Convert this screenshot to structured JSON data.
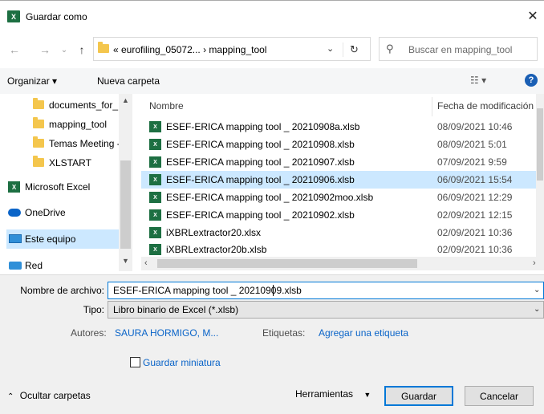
{
  "window": {
    "app_icon": "excel-icon",
    "title": "Guardar como",
    "close_label": "✕"
  },
  "address_bar": {
    "path_text": "« eurofiling_05072...  ›  mapping_tool",
    "search_placeholder": "Buscar en mapping_tool"
  },
  "toolbar": {
    "organize_label": "Organizar ▾",
    "new_folder_label": "Nueva carpeta"
  },
  "nav_pane": {
    "items": [
      {
        "label": "documents_for_",
        "icon": "folder-icon"
      },
      {
        "label": "mapping_tool",
        "icon": "folder-icon"
      },
      {
        "label": "Temas Meeting -",
        "icon": "folder-icon"
      },
      {
        "label": "XLSTART",
        "icon": "folder-icon"
      },
      {
        "label": "Microsoft Excel",
        "icon": "excel-icon"
      },
      {
        "label": "OneDrive",
        "icon": "cloud-icon"
      },
      {
        "label": "Este equipo",
        "icon": "computer-icon",
        "selected": true
      },
      {
        "label": "Red",
        "icon": "network-icon"
      }
    ]
  },
  "file_list": {
    "columns": [
      "Nombre",
      "Fecha de modificación"
    ],
    "rows": [
      {
        "name": "ESEF-ERICA mapping tool _ 20210908a.xlsb",
        "date": "08/09/2021 10:46"
      },
      {
        "name": "ESEF-ERICA mapping tool _ 20210908.xlsb",
        "date": "08/09/2021 5:01"
      },
      {
        "name": "ESEF-ERICA mapping tool _ 20210907.xlsb",
        "date": "07/09/2021 9:59"
      },
      {
        "name": "ESEF-ERICA mapping tool _ 20210906.xlsb",
        "date": "06/09/2021 15:54",
        "selected": true
      },
      {
        "name": "ESEF-ERICA mapping tool _ 20210902moo.xlsb",
        "date": "06/09/2021 12:29"
      },
      {
        "name": "ESEF-ERICA mapping tool _ 20210902.xlsb",
        "date": "02/09/2021 12:15"
      },
      {
        "name": "iXBRLextractor20.xlsx",
        "date": "02/09/2021 10:36"
      },
      {
        "name": "iXBRLextractor20b.xlsb",
        "date": "02/09/2021 10:36"
      }
    ]
  },
  "form": {
    "filename_label": "Nombre de archivo:",
    "filename_value": "ESEF-ERICA mapping tool _ 20210909.xlsb",
    "type_label": "Tipo:",
    "type_value": "Libro binario de Excel (*.xlsb)",
    "authors_label": "Autores:",
    "authors_value": "SAURA HORMIGO, M...",
    "tags_label": "Etiquetas:",
    "tags_value": "Agregar una etiqueta",
    "thumbnail_label": "Guardar miniatura"
  },
  "footer": {
    "hide_folders_label": "Ocultar carpetas",
    "tools_label": "Herramientas",
    "save_label": "Guardar",
    "cancel_label": "Cancelar"
  },
  "colors": {
    "accent": "#0078d7",
    "selection": "#cce8ff",
    "link": "#0a64c8",
    "excel_green": "#1d6f42",
    "folder_yellow": "#f4c64d"
  }
}
